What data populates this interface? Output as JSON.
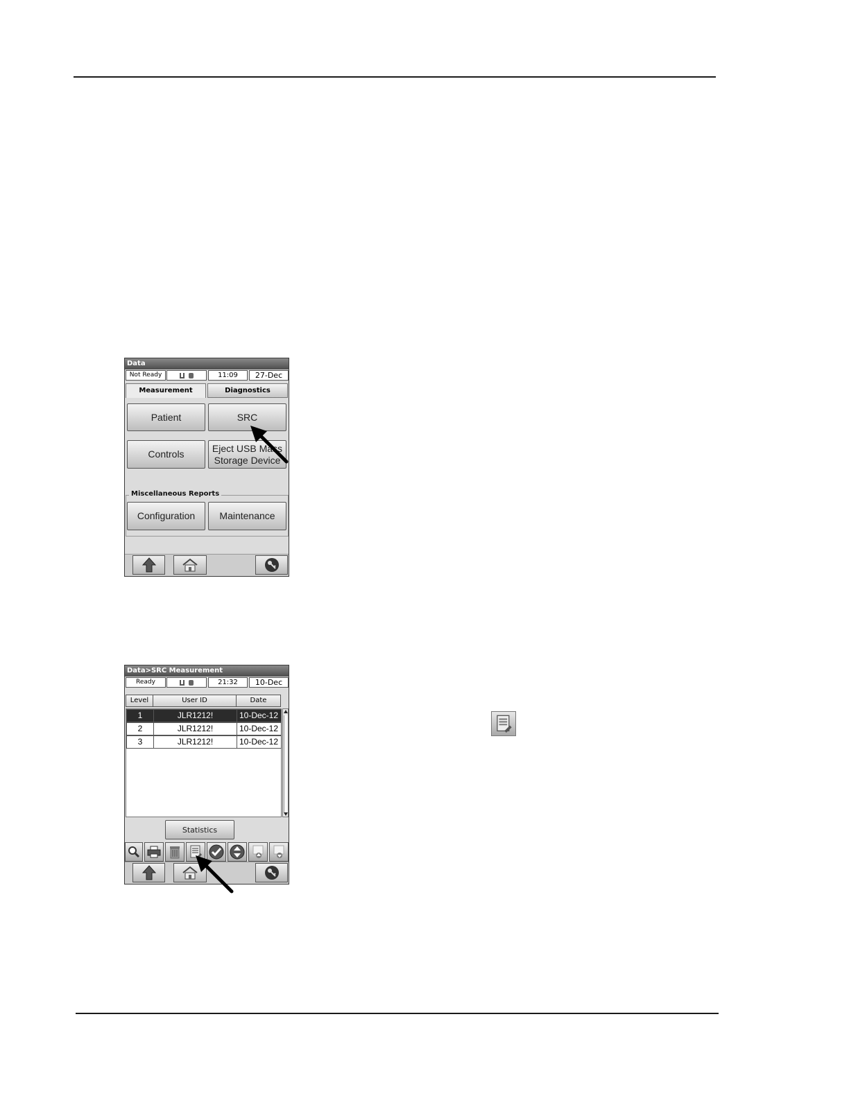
{
  "screen1": {
    "title": "Data",
    "status": {
      "state": "Not Ready",
      "time": "11:09",
      "date": "27-Dec"
    },
    "tabs": [
      "Measurement",
      "Diagnostics"
    ],
    "buttons": {
      "patient": "Patient",
      "src": "SRC",
      "controls": "Controls",
      "eject_line1": "Eject USB Mass",
      "eject_line2": "Storage Device",
      "configuration": "Configuration",
      "maintenance": "Maintenance"
    },
    "group_label": "Miscellaneous Reports",
    "nav_icons": [
      "up-arrow-icon",
      "home-icon",
      "key-icon"
    ]
  },
  "screen2": {
    "title": "Data>SRC Measurement",
    "status": {
      "state": "Ready",
      "time": "21:32",
      "date": "10-Dec"
    },
    "columns": [
      "Level",
      "User ID",
      "Date"
    ],
    "rows": [
      {
        "level": "1",
        "user_id": "JLR1212!",
        "date": "10-Dec-12",
        "selected": true
      },
      {
        "level": "2",
        "user_id": "JLR1212!",
        "date": "10-Dec-12",
        "selected": false
      },
      {
        "level": "3",
        "user_id": "JLR1212!",
        "date": "10-Dec-12",
        "selected": false
      }
    ],
    "statistics_label": "Statistics",
    "toolbar_icons": [
      "magnifier-icon",
      "printer-icon",
      "trash-icon",
      "document-edit-icon",
      "checkmark-icon",
      "sort-icon",
      "page-up-icon",
      "page-down-icon"
    ],
    "nav_icons": [
      "up-arrow-icon",
      "home-icon",
      "key-icon"
    ]
  },
  "inline_icon": "document-edit-icon"
}
